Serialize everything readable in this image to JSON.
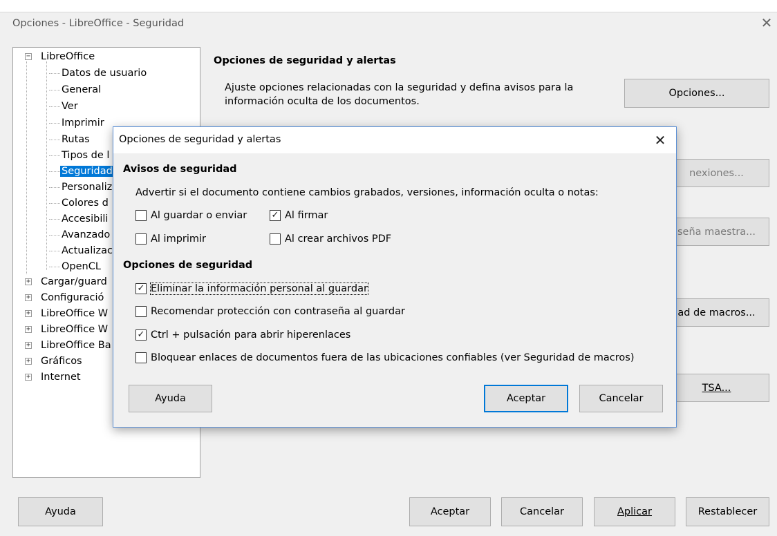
{
  "window": {
    "title": "Opciones - LibreOffice - Seguridad"
  },
  "tree": {
    "root": "LibreOffice",
    "children": [
      "Datos de usuario",
      "General",
      "Ver",
      "Imprimir",
      "Rutas",
      "Tipos de l",
      "Seguridad",
      "Personaliz",
      "Colores d",
      "Accesibili",
      "Avanzado",
      "Actualizac",
      "OpenCL"
    ],
    "selected": "Seguridad",
    "collapsed": [
      "Cargar/guard",
      "Configuració",
      "LibreOffice W",
      "LibreOffice W",
      "LibreOffice Ba",
      "Gráficos",
      "Internet"
    ]
  },
  "panel": {
    "section1_title": "Opciones de seguridad y alertas",
    "section1_desc": "Ajuste opciones relacionadas con la seguridad y defina avisos para la información oculta de los documentos.",
    "options_button": "Opciones...",
    "connections_button_fragment": "nexiones...",
    "master_password_fragment": "seña maestra...",
    "macro_security_fragment": "ad de macros...",
    "tsa_button_fragment": "TSA..."
  },
  "dialog": {
    "title": "Opciones de seguridad y alertas",
    "warnings_heading": "Avisos de seguridad",
    "warnings_desc": "Advertir si el documento contiene cambios grabados, versiones, información oculta o notas:",
    "warning_checks": [
      {
        "label": "Al guardar o enviar",
        "checked": false
      },
      {
        "label": "Al firmar",
        "checked": true
      },
      {
        "label": "Al imprimir",
        "checked": false
      },
      {
        "label": "Al crear archivos PDF",
        "checked": false
      }
    ],
    "options_heading": "Opciones de seguridad",
    "option_checks": [
      {
        "label": "Eliminar la información personal al guardar",
        "checked": true
      },
      {
        "label": "Recomendar protección con contraseña al guardar",
        "checked": false
      },
      {
        "label": "Ctrl + pulsación para abrir hiperenlaces",
        "checked": true
      },
      {
        "label": "Bloquear enlaces de documentos fuera de las ubicaciones confiables (ver Seguridad de macros)",
        "checked": false
      }
    ],
    "help_button": "Ayuda",
    "ok_button": "Aceptar",
    "cancel_button": "Cancelar"
  },
  "footer": {
    "help_button": "Ayuda",
    "ok_button": "Aceptar",
    "cancel_button": "Cancelar",
    "apply_button": "Aplicar",
    "reset_button": "Restablecer"
  },
  "icons": {
    "close": "close-icon",
    "expand": "plus-expander-icon",
    "collapse": "minus-expander-icon",
    "check": "checkmark-icon"
  },
  "colors": {
    "selection": "#0078d7",
    "dialog_border": "#5a8fd6",
    "background": "#f0f0f0"
  }
}
